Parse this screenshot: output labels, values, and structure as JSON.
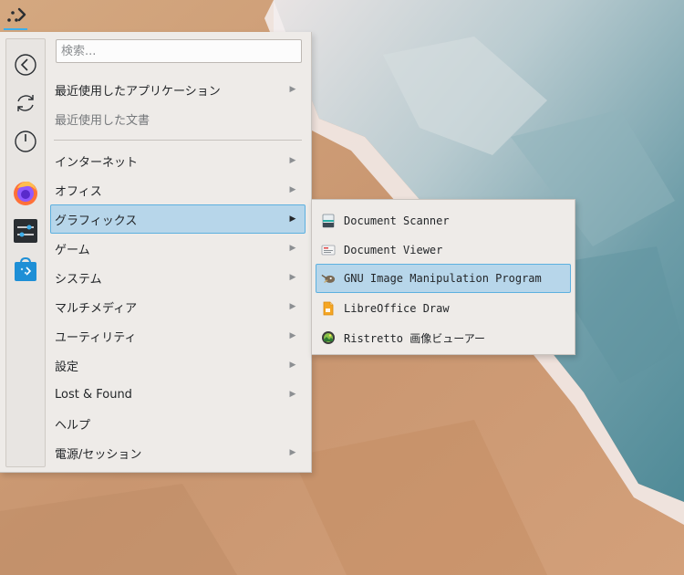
{
  "panel": {
    "launcher_icon": "app-launcher-icon"
  },
  "favorites": [
    {
      "name": "back",
      "icon": "back-arrow-icon"
    },
    {
      "name": "refresh",
      "icon": "refresh-icon"
    },
    {
      "name": "power",
      "icon": "power-icon"
    },
    {
      "name": "firefox",
      "icon": "firefox-icon"
    },
    {
      "name": "settings",
      "icon": "system-settings-icon"
    },
    {
      "name": "discover",
      "icon": "software-center-icon"
    }
  ],
  "search": {
    "placeholder": "検索...",
    "value": ""
  },
  "categories": [
    {
      "label": "最近使用したアプリケーション",
      "has_submenu": true
    },
    {
      "label": "最近使用した文書",
      "has_submenu": false,
      "disabled": true
    },
    {
      "label": "インターネット",
      "has_submenu": true
    },
    {
      "label": "オフィス",
      "has_submenu": true
    },
    {
      "label": "グラフィックス",
      "has_submenu": true,
      "selected": true
    },
    {
      "label": "ゲーム",
      "has_submenu": true
    },
    {
      "label": "システム",
      "has_submenu": true
    },
    {
      "label": "マルチメディア",
      "has_submenu": true
    },
    {
      "label": "ユーティリティ",
      "has_submenu": true
    },
    {
      "label": "設定",
      "has_submenu": true
    },
    {
      "label": "Lost & Found",
      "has_submenu": true
    },
    {
      "label": "ヘルプ",
      "has_submenu": false
    },
    {
      "label": "電源/セッション",
      "has_submenu": true
    }
  ],
  "submenu": {
    "items": [
      {
        "label": "Document Scanner",
        "icon": "scanner-icon"
      },
      {
        "label": "Document Viewer",
        "icon": "document-viewer-icon"
      },
      {
        "label": "GNU Image Manipulation Program",
        "icon": "gimp-icon",
        "selected": true
      },
      {
        "label": "LibreOffice Draw",
        "icon": "libreoffice-draw-icon"
      },
      {
        "label": "Ristretto 画像ビューアー",
        "icon": "image-viewer-icon"
      }
    ]
  },
  "colors": {
    "highlight": "#b7d6ea",
    "highlight_border": "#5db0df",
    "menu_bg": "#eeebe8"
  }
}
